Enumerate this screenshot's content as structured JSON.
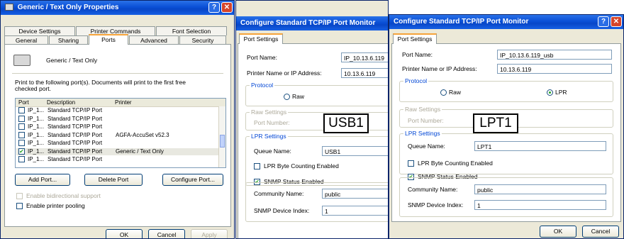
{
  "props": {
    "title": "Generic / Text Only Properties",
    "tabs_row1": [
      "Device Settings",
      "Printer Commands",
      "Font Selection"
    ],
    "tabs_row2": [
      "General",
      "Sharing",
      "Ports",
      "Advanced",
      "Security"
    ],
    "printer_name": "Generic / Text Only",
    "print_to_text": "Print to the following port(s). Documents will print to the first free checked port.",
    "columns": [
      "Port",
      "Description",
      "Printer"
    ],
    "ports": [
      {
        "port": "IP_1...",
        "description": "Standard TCP/IP Port",
        "printer": "",
        "checked": false
      },
      {
        "port": "IP_1...",
        "description": "Standard TCP/IP Port",
        "printer": "",
        "checked": false
      },
      {
        "port": "IP_1...",
        "description": "Standard TCP/IP Port",
        "printer": "",
        "checked": false
      },
      {
        "port": "IP_1...",
        "description": "Standard TCP/IP Port",
        "printer": "AGFA-AccuSet v52.3",
        "checked": false
      },
      {
        "port": "IP_1...",
        "description": "Standard TCP/IP Port",
        "printer": "",
        "checked": false
      },
      {
        "port": "IP_1...",
        "description": "Standard TCP/IP Port",
        "printer": "Generic / Text Only",
        "checked": true
      },
      {
        "port": "IP_1...",
        "description": "Standard TCP/IP Port",
        "printer": "",
        "checked": false
      }
    ],
    "add_port": "Add Port...",
    "delete_port": "Delete Port",
    "configure_port": "Configure Port...",
    "bidirectional": "Enable bidirectional support",
    "pooling": "Enable printer pooling",
    "ok": "OK",
    "cancel": "Cancel",
    "apply": "Apply"
  },
  "usb": {
    "title": "Configure Standard TCP/IP Port Monitor",
    "tab": "Port Settings",
    "port_name_label": "Port Name:",
    "port_name": "IP_10.13.6.119",
    "printer_name_label": "Printer Name or IP Address:",
    "printer_ip": "10.13.6.119",
    "protocol": "Protocol",
    "raw": "Raw",
    "raw_settings": "Raw Settings",
    "port_number_label": "Port Number:",
    "callout": "USB1",
    "lpr_settings": "LPR Settings",
    "queue_label": "Queue Name:",
    "queue": "USB1",
    "lpr_byte": "LPR Byte Counting Enabled",
    "snmp": "SNMP Status Enabled",
    "community_label": "Community Name:",
    "community": "public",
    "snmp_index_label": "SNMP Device Index:",
    "snmp_index": "1"
  },
  "lpt": {
    "title": "Configure Standard TCP/IP Port Monitor",
    "tab": "Port Settings",
    "port_name_label": "Port Name:",
    "port_name": "IP_10.13.6.119_usb",
    "printer_name_label": "Printer Name or IP Address:",
    "printer_ip": "10.13.6.119",
    "protocol": "Protocol",
    "raw": "Raw",
    "lpr": "LPR",
    "raw_settings": "Raw Settings",
    "port_number_label": "Port Number:",
    "callout": "LPT1",
    "lpr_settings": "LPR Settings",
    "queue_label": "Queue Name:",
    "queue": "LPT1",
    "lpr_byte": "LPR Byte Counting Enabled",
    "snmp": "SNMP Status Enabled",
    "community_label": "Community Name:",
    "community": "public",
    "snmp_index_label": "SNMP Device Index:",
    "snmp_index": "1",
    "ok": "OK",
    "cancel": "Cancel"
  },
  "colors": {
    "titlebar": "#0a4fd6",
    "dialog_bg": "#ece9d8",
    "group_title": "#0046d5",
    "check_green": "#21a121"
  }
}
